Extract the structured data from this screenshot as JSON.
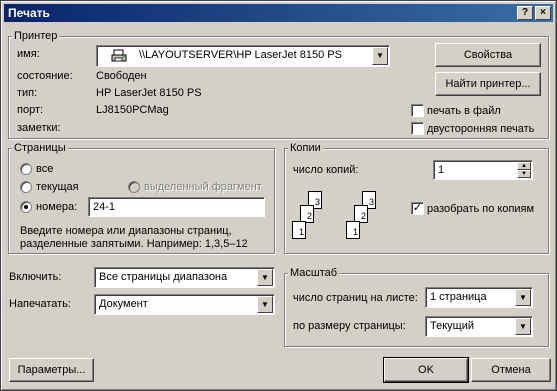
{
  "window": {
    "title": "Печать",
    "help_label": "?",
    "close_label": "×"
  },
  "printer": {
    "group_label": "Принтер",
    "name_label": "имя:",
    "name_value": "\\\\LAYOUTSERVER\\HP LaserJet 8150 PS",
    "status_label": "состояние:",
    "status_value": "Свободен",
    "type_label": "тип:",
    "type_value": "HP LaserJet 8150 PS",
    "port_label": "порт:",
    "port_value": "LJ8150PCMag",
    "notes_label": "заметки:",
    "notes_value": "",
    "properties_button": "Свойства",
    "find_button": "Найти принтер...",
    "print_to_file_label": "печать в файл",
    "print_to_file_checked": false,
    "duplex_label": "двусторонняя печать",
    "duplex_checked": false
  },
  "pages": {
    "group_label": "Страницы",
    "all_label": "все",
    "current_label": "текущая",
    "selection_label": "выделенный фрагмент",
    "numbers_label": "номера:",
    "numbers_value": "24-1",
    "selected_option": "numbers",
    "hint": "Введите номера или диапазоны страниц, разделенные запятыми. Например: 1,3,5–12"
  },
  "copies": {
    "group_label": "Копии",
    "count_label": "число копий:",
    "count_value": "1",
    "collate_label": "разобрать по копиям",
    "collate_checked": true,
    "page_numbers": [
      "1",
      "2",
      "3"
    ]
  },
  "include": {
    "label": "Включить:",
    "value": "Все страницы диапазона"
  },
  "print_what": {
    "label": "Напечатать:",
    "value": "Документ"
  },
  "zoom": {
    "group_label": "Масштаб",
    "pages_per_sheet_label": "число страниц на листе:",
    "pages_per_sheet_value": "1 страница",
    "scale_label": "по размеру страницы:",
    "scale_value": "Текущий"
  },
  "footer": {
    "options_button": "Параметры...",
    "ok_button": "OK",
    "cancel_button": "Отмена"
  }
}
